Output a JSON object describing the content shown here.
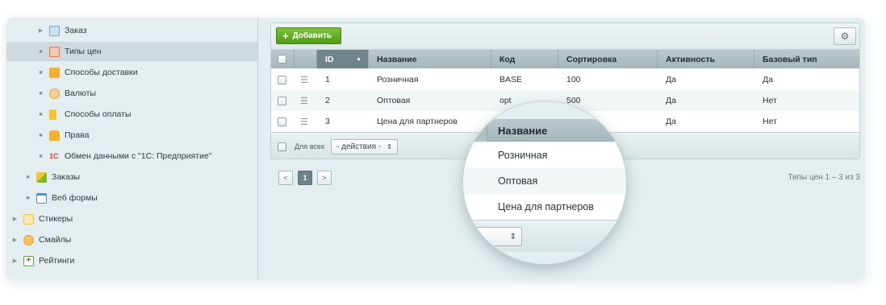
{
  "sidebar": {
    "items": [
      {
        "label": "Заказ",
        "marker": "▶",
        "icon": "order-icon",
        "color": "#7aa8d6"
      },
      {
        "label": "Типы цен",
        "marker": "■",
        "icon": "price-types-icon",
        "color": "#e07a4a"
      },
      {
        "label": "Способы доставки",
        "marker": "■",
        "icon": "delivery-icon",
        "color": "#f0b030"
      },
      {
        "label": "Валюты",
        "marker": "■",
        "icon": "currency-icon",
        "color": "#e8a030"
      },
      {
        "label": "Способы оплаты",
        "marker": "■",
        "icon": "payment-icon",
        "color": "#f2c430"
      },
      {
        "label": "Права",
        "marker": "■",
        "icon": "lock-icon",
        "color": "#f0b030"
      },
      {
        "label": "Обмен данными с \"1С: Предприятие\"",
        "marker": "■",
        "icon": "1c-icon",
        "color": "#d9342b"
      },
      {
        "label": "Заказы",
        "marker": "■",
        "icon": "orders-icon",
        "color": "#7ab830"
      },
      {
        "label": "Веб формы",
        "marker": "■",
        "icon": "web-forms-icon",
        "color": "#4a90d0"
      },
      {
        "label": "Стикеры",
        "marker": "▶",
        "icon": "stickers-icon",
        "color": "#f0c050"
      },
      {
        "label": "Смайлы",
        "marker": "▶",
        "icon": "smiley-icon",
        "color": "#e8a030"
      },
      {
        "label": "Рейтинги",
        "marker": "▶",
        "icon": "ratings-icon",
        "color": "#5aa040"
      }
    ]
  },
  "toolbar": {
    "add_label": "Добавить"
  },
  "table": {
    "columns": [
      "ID",
      "Название",
      "Код",
      "Сортировка",
      "Активность",
      "Базовый тип"
    ],
    "rows": [
      {
        "id": "1",
        "name": "Розничная",
        "code": "BASE",
        "sort": "100",
        "active": "Да",
        "base": "Да"
      },
      {
        "id": "2",
        "name": "Оптовая",
        "code": "opt",
        "sort": "500",
        "active": "Да",
        "base": "Нет"
      },
      {
        "id": "3",
        "name": "Цена для партнеров",
        "code": "",
        "sort": "",
        "active": "Да",
        "base": "Нет"
      }
    ],
    "footer": {
      "for_all": "Для всех",
      "actions": "- действия -"
    }
  },
  "pager": {
    "prev": "<",
    "current": "1",
    "next": ">",
    "info": "Типы цен 1 – 3 из 3"
  },
  "magnifier": {
    "header": "Название",
    "rows": [
      "Розничная",
      "Оптовая",
      "Цена для партнеров"
    ],
    "actions_fragment": "ия -"
  },
  "colors": {
    "add_button": "#5ca61e",
    "sorted_header": "#70858b",
    "active_sidebar": "#cedade"
  }
}
